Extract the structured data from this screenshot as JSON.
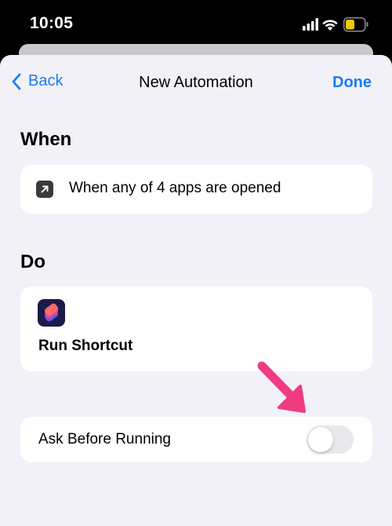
{
  "status_bar": {
    "time": "10:05",
    "icons": [
      "cellular-signal-icon",
      "wifi-icon",
      "battery-icon"
    ],
    "battery_color": "#f5c800"
  },
  "nav": {
    "back_label": "Back",
    "title": "New Automation",
    "done_label": "Done",
    "accent_color": "#1a7cf5"
  },
  "when_section": {
    "title": "When",
    "trigger_text": "When any of 4 apps are opened",
    "icon": "app-open-arrow-icon"
  },
  "do_section": {
    "title": "Do",
    "action_icon": "shortcuts-app-icon",
    "action_label": "Run Shortcut"
  },
  "ask_before_running": {
    "label": "Ask Before Running",
    "enabled": false
  },
  "annotation": {
    "icon": "pink-arrow-icon",
    "color": "#f03a82"
  }
}
